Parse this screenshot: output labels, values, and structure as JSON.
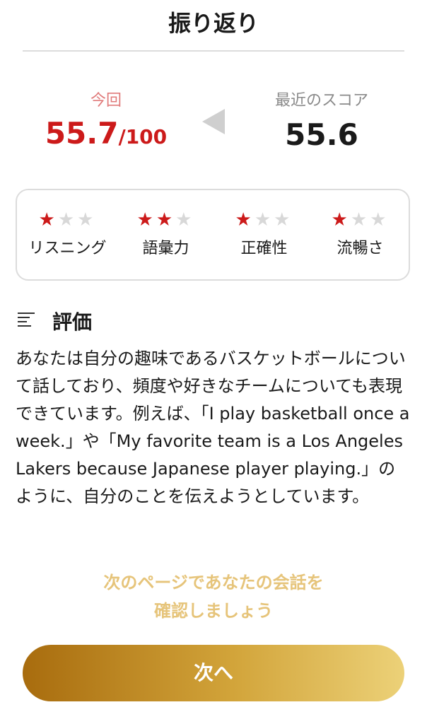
{
  "header": {
    "title": "振り返り"
  },
  "score": {
    "current_label": "今回",
    "current_value": "55.7",
    "current_max": "/100",
    "recent_label": "最近のスコア",
    "recent_value": "55.6"
  },
  "skills": [
    {
      "label": "リスニング",
      "stars": 1,
      "max_stars": 3
    },
    {
      "label": "語彙力",
      "stars": 2,
      "max_stars": 3
    },
    {
      "label": "正確性",
      "stars": 1,
      "max_stars": 3
    },
    {
      "label": "流暢さ",
      "stars": 1,
      "max_stars": 3
    }
  ],
  "evaluation": {
    "title": "評価",
    "text": "あなたは自分の趣味であるバスケットボールについて話しており、頻度や好きなチームについても表現できています。例えば、「I play basketball once a week.」や「My favorite team is a Los Angeles Lakers because Japanese player playing.」のように、自分のことを伝えようとしています。"
  },
  "footer": {
    "hint_line1": "次のページであなたの会話を",
    "hint_line2": "確認しましょう",
    "next_label": "次へ"
  },
  "colors": {
    "accent_red": "#cc1a1a",
    "star_off": "#d8d8d8",
    "gold_start": "#a86c0e",
    "gold_end": "#ecd178",
    "hint_gold": "#e6c47a"
  }
}
